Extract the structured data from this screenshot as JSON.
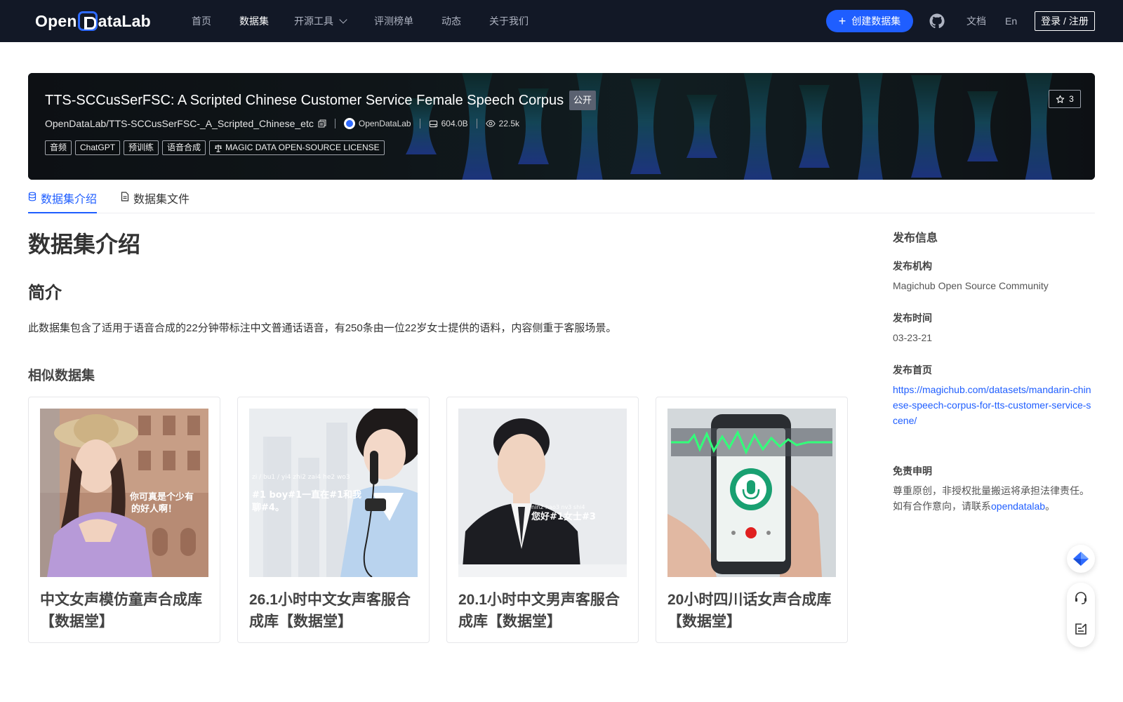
{
  "nav": {
    "logo_text_left": "Open",
    "logo_text_right": "ataLab",
    "items": [
      {
        "label": "首页"
      },
      {
        "label": "数据集"
      },
      {
        "label": "开源工具"
      },
      {
        "label": "评测榜单"
      },
      {
        "label": "动态"
      },
      {
        "label": "关于我们"
      }
    ],
    "create_label": "创建数据集",
    "docs_label": "文档",
    "lang_label": "En",
    "login_label": "登录 / 注册"
  },
  "banner": {
    "title": "TTS-SCCusSerFSC: A Scripted Chinese Customer Service Female Speech Corpus",
    "public_badge": "公开",
    "star_count": "3",
    "repo_path": "OpenDataLab/TTS-SCCusSerFSC-_A_Scripted_Chinese_etc",
    "org_name": "OpenDataLab",
    "size": "604.0B",
    "views": "22.5k",
    "tags": [
      "音频",
      "ChatGPT",
      "预训练",
      "语音合成"
    ],
    "license": "MAGIC DATA OPEN-SOURCE LICENSE"
  },
  "tabs": [
    {
      "label": "数据集介绍"
    },
    {
      "label": "数据集文件"
    }
  ],
  "main": {
    "heading": "数据集介绍",
    "subheading": "简介",
    "intro_text": "此数据集包含了适用于语音合成的22分钟带标注中文普通话语音，有250条由一位22岁女士提供的语料，内容侧重于客服场景。",
    "similar_title": "相似数据集",
    "cards": [
      {
        "title": "中文女声模仿童声合成库【数据堂】",
        "overlay": [
          "你可真是个少有",
          "的好人啊！"
        ]
      },
      {
        "title": "26.1小时中文女声客服合成库【数据堂】",
        "overlay": [
          "#1 boy#1一直在#1和我",
          "聊#4。"
        ]
      },
      {
        "title": "20.1小时中文男声客服合成库【数据堂】",
        "overlay": [
          "您好#1女士#3"
        ]
      },
      {
        "title": "20小时四川话女声合成库【数据堂】",
        "overlay": []
      }
    ]
  },
  "sidebar": {
    "heading": "发布信息",
    "org_label": "发布机构",
    "org_value": "Magichub Open Source Community",
    "date_label": "发布时间",
    "date_value": "03-23-21",
    "home_label": "发布首页",
    "home_url": "https://magichub.com/datasets/mandarin-chinese-speech-corpus-for-tts-customer-service-scene/",
    "disclaimer_label": "免责申明",
    "disclaimer_line1": "尊重原创，非授权批量搬运将承担法律责任。",
    "disclaimer_line2_prefix": "如有合作意向，请联系",
    "disclaimer_link": "opendatalab",
    "disclaimer_line2_suffix": "。"
  },
  "colors": {
    "nav_bg": "#121826",
    "accent": "#1f5eff",
    "banner_bg": "#0f1318"
  },
  "icons": [
    "github-icon",
    "star-icon",
    "copy-icon",
    "storage-icon",
    "eye-icon",
    "license-icon",
    "database-icon",
    "file-icon",
    "back-to-top-icon",
    "headset-icon",
    "feedback-icon"
  ]
}
